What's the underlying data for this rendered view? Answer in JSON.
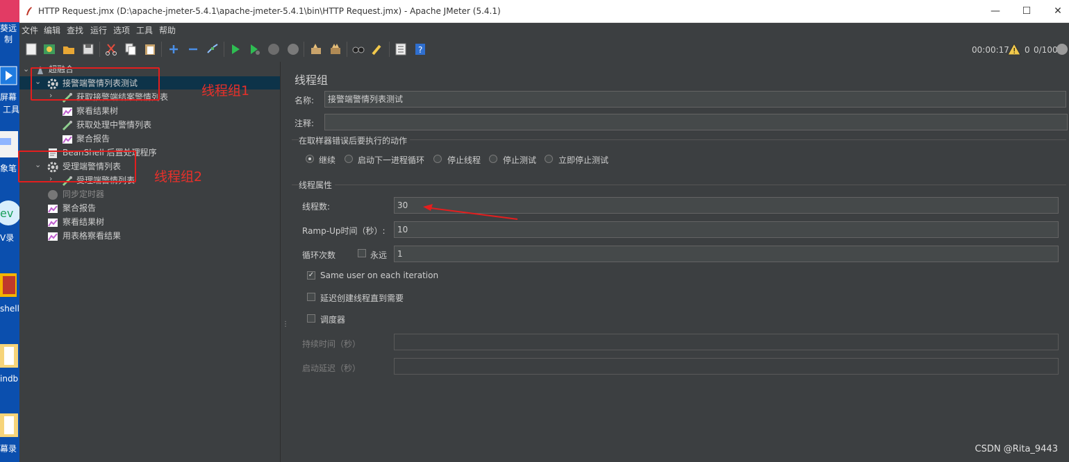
{
  "window": {
    "title": "HTTP Request.jmx (D:\\apache-jmeter-5.4.1\\apache-jmeter-5.4.1\\bin\\HTTP Request.jmx) - Apache JMeter (5.4.1)",
    "minimize": "—",
    "maximize": "☐",
    "close": "✕"
  },
  "desktop": {
    "labels": [
      "葵远",
      "制",
      "屏幕",
      "工具",
      "象笔",
      "V录",
      "shell",
      "indb",
      "幕录"
    ]
  },
  "menu": [
    "文件",
    "编辑",
    "查找",
    "运行",
    "选项",
    "工具",
    "帮助"
  ],
  "toolbar_status": {
    "elapsed": "00:00:17",
    "warnings": "0",
    "threads": "0/100"
  },
  "tree": {
    "root": "超融合",
    "group1": "接警端警情列表测试",
    "g1_child1": "获取接警端结案警情列表",
    "g1_child2": "察看结果树",
    "g1_child3": "获取处理中警情列表",
    "g1_child4": "聚合报告",
    "beanshell": "BeanShell 后置处理程序",
    "group2": "受理端警情列表",
    "g2_child1": "受理端警情列表",
    "timer": "同步定时器",
    "agg": "聚合报告",
    "results_tree": "察看结果树",
    "table_results": "用表格察看结果"
  },
  "annotations": {
    "group1": "线程组1",
    "group2": "线程组2"
  },
  "panel": {
    "title": "线程组",
    "name_label": "名称:",
    "name_value": "接警端警情列表测试",
    "comment_label": "注释:",
    "comment_value": "",
    "error_action_title": "在取样器错误后要执行的动作",
    "error_actions": [
      "继续",
      "启动下一进程循环",
      "停止线程",
      "停止测试",
      "立即停止测试"
    ],
    "error_action_selected": 0,
    "thread_props_title": "线程属性",
    "threads_label": "线程数:",
    "threads_value": "30",
    "rampup_label": "Ramp-Up时间（秒）:",
    "rampup_value": "10",
    "loop_label": "循环次数",
    "forever_label": "永远",
    "loop_value": "1",
    "same_user_label": "Same user on each iteration",
    "same_user_checked": true,
    "delay_label": "延迟创建线程直到需要",
    "scheduler_label": "调度器",
    "duration_label": "持续时间（秒）",
    "duration_value": "",
    "startup_delay_label": "启动延迟（秒）",
    "startup_delay_value": ""
  },
  "watermark": "CSDN @Rita_9443",
  "colors": {
    "annotation": "#e41e1e",
    "selection": "#0d3349",
    "accent": "#4a8fe7"
  }
}
